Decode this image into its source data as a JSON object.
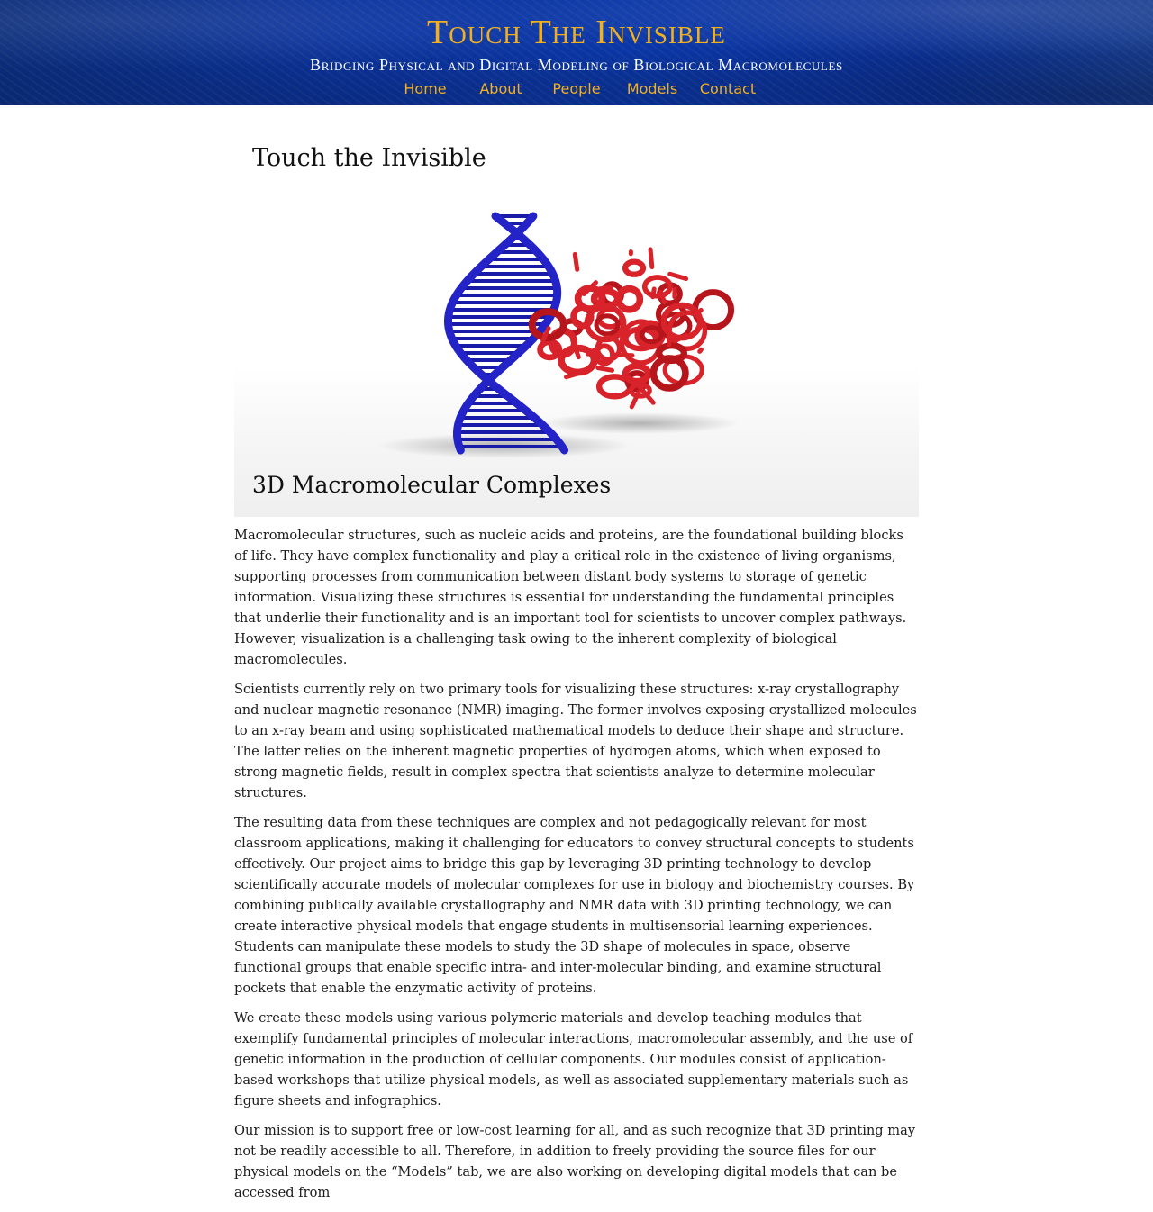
{
  "header": {
    "title": "Touch The Invisible",
    "tagline": "Bridging Physical and Digital Modeling of Biological Macromolecules",
    "nav": [
      {
        "label": "Home"
      },
      {
        "label": "About"
      },
      {
        "label": "People"
      },
      {
        "label": "Models"
      },
      {
        "label": "Contact"
      }
    ]
  },
  "hero": {
    "title": "Touch the Invisible",
    "caption": "3D Macromolecular Complexes",
    "dna_color": "#2323c8",
    "protein_color": "#d8232a"
  },
  "paragraphs": [
    "Macromolecular structures, such as nucleic acids and proteins, are the foundational building blocks of life. They have complex functionality and play a critical role in the existence of living organisms, supporting processes from communication between distant body systems to storage of genetic information. Visualizing these structures is essential for understanding the fundamental principles that underlie their functionality and is an important tool for scientists to uncover complex pathways. However, visualization is a challenging task owing to the inherent complexity of biological macromolecules.",
    "Scientists currently rely on two primary tools for visualizing these structures: x-ray crystallography and nuclear magnetic resonance (NMR) imaging. The former involves exposing crystallized molecules to an x-ray beam and using sophisticated mathematical models to deduce their shape and structure. The latter relies on the inherent magnetic properties of hydrogen atoms, which when exposed to strong magnetic fields, result in complex spectra that scientists analyze to determine molecular structures.",
    "The resulting data from these techniques are complex and not pedagogically relevant for most classroom applications, making it challenging for educators to convey structural concepts to students effectively. Our project aims to bridge this gap by leveraging 3D printing technology to develop scientifically accurate models of molecular complexes for use in biology and biochemistry courses. By combining publically available crystallography and NMR data with 3D printing technology, we can create interactive physical models that engage students in multisensorial learning experiences. Students can manipulate these models to study the 3D shape of molecules in space, observe functional groups that enable specific intra- and inter-molecular binding, and examine structural pockets that enable the enzymatic activity of proteins.",
    "We create these models using various polymeric materials and develop teaching modules that exemplify fundamental principles of molecular interactions, macromolecular assembly, and the use of genetic information in the production of cellular components. Our modules consist of application-based workshops that utilize physical models, as well as associated supplementary materials such as figure sheets and infographics.",
    "Our mission is to support free or low-cost learning for all, and as such recognize that 3D printing may not be readily accessible to all. Therefore, in addition to freely providing the source files for our physical models on the “Models” tab, we are also working on developing digital models that can be accessed from"
  ]
}
